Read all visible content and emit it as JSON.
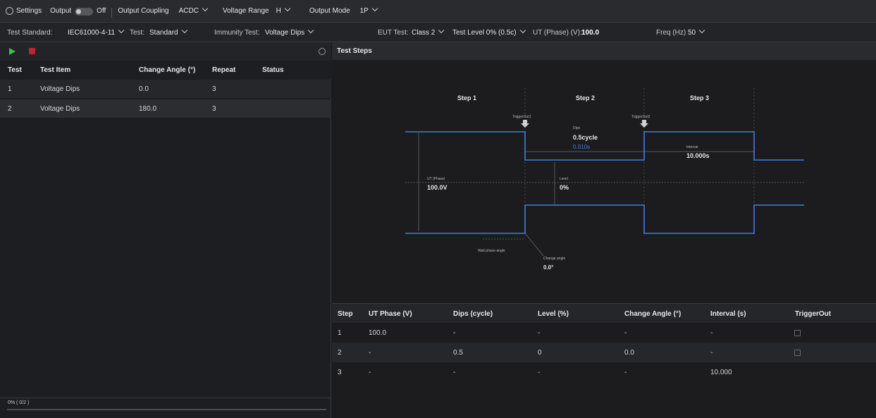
{
  "header": {
    "settings_label": "Settings",
    "output_label": "Output",
    "output_state": "Off",
    "coupling_label": "Output Coupling",
    "coupling_value": "ACDC",
    "range_label": "Voltage Range",
    "range_value": "H",
    "mode_label": "Output Mode",
    "mode_value": "1P"
  },
  "subheader": {
    "standard_label": "Test Standard:",
    "standard_value": "IEC61000-4-11",
    "test_label": "Test:",
    "test_value": "Standard",
    "immunity_label": "Immunity Test:",
    "immunity_value": "Voltage Dips",
    "eut_label": "EUT Test:",
    "eut_value": "Class 2",
    "level_value": "Test Level 0% (0.5c)",
    "ut_label": "UT (Phase) (V):",
    "ut_value": "100.0",
    "freq_label": "Freq (Hz)",
    "freq_value": "50"
  },
  "left_table": {
    "columns": [
      "Test",
      "Test Item",
      "Change Angle (°)",
      "Repeat",
      "Status"
    ],
    "rows": [
      {
        "test": "1",
        "item": "Voltage Dips",
        "angle": "0.0",
        "repeat": "3",
        "status": ""
      },
      {
        "test": "2",
        "item": "Voltage Dips",
        "angle": "180.0",
        "repeat": "3",
        "status": ""
      }
    ],
    "progress_text": "0% ( 0/2 )",
    "progress": 0
  },
  "right_panel": {
    "title": "Test Steps"
  },
  "diagram": {
    "steps": [
      "Step 1",
      "Step 2",
      "Step 3"
    ],
    "trigger1": "TriggerOut1",
    "trigger2": "TriggerOut2",
    "dips_label": "Dips",
    "dips_cycle": "0.5cycle",
    "dips_time": "0.010s",
    "interval_label": "Interval",
    "interval_value": "10.000s",
    "ut_label": "UT (Phase)",
    "ut_value": "100.0V",
    "level_label": "Level",
    "level_value": "0%",
    "wait_label": "Wait phase-angle",
    "change_label": "Change angle",
    "change_value": "0.0°"
  },
  "steps_table": {
    "columns": [
      "Step",
      "UT Phase (V)",
      "Dips (cycle)",
      "Level (%)",
      "Change Angle (°)",
      "Interval (s)",
      "TriggerOut"
    ],
    "rows": [
      {
        "step": "1",
        "ut": "100.0",
        "dips": "-",
        "level": "-",
        "angle": "-",
        "interval": "-"
      },
      {
        "step": "2",
        "ut": "-",
        "dips": "0.5",
        "level": "0",
        "angle": "0.0",
        "interval": "-"
      },
      {
        "step": "3",
        "ut": "-",
        "dips": "-",
        "level": "-",
        "angle": "-",
        "interval": "10.000"
      }
    ]
  },
  "colors": {
    "accent_blue": "#3d7fe0",
    "play_green": "#3fbf4a",
    "stop_red": "#b8262e"
  }
}
